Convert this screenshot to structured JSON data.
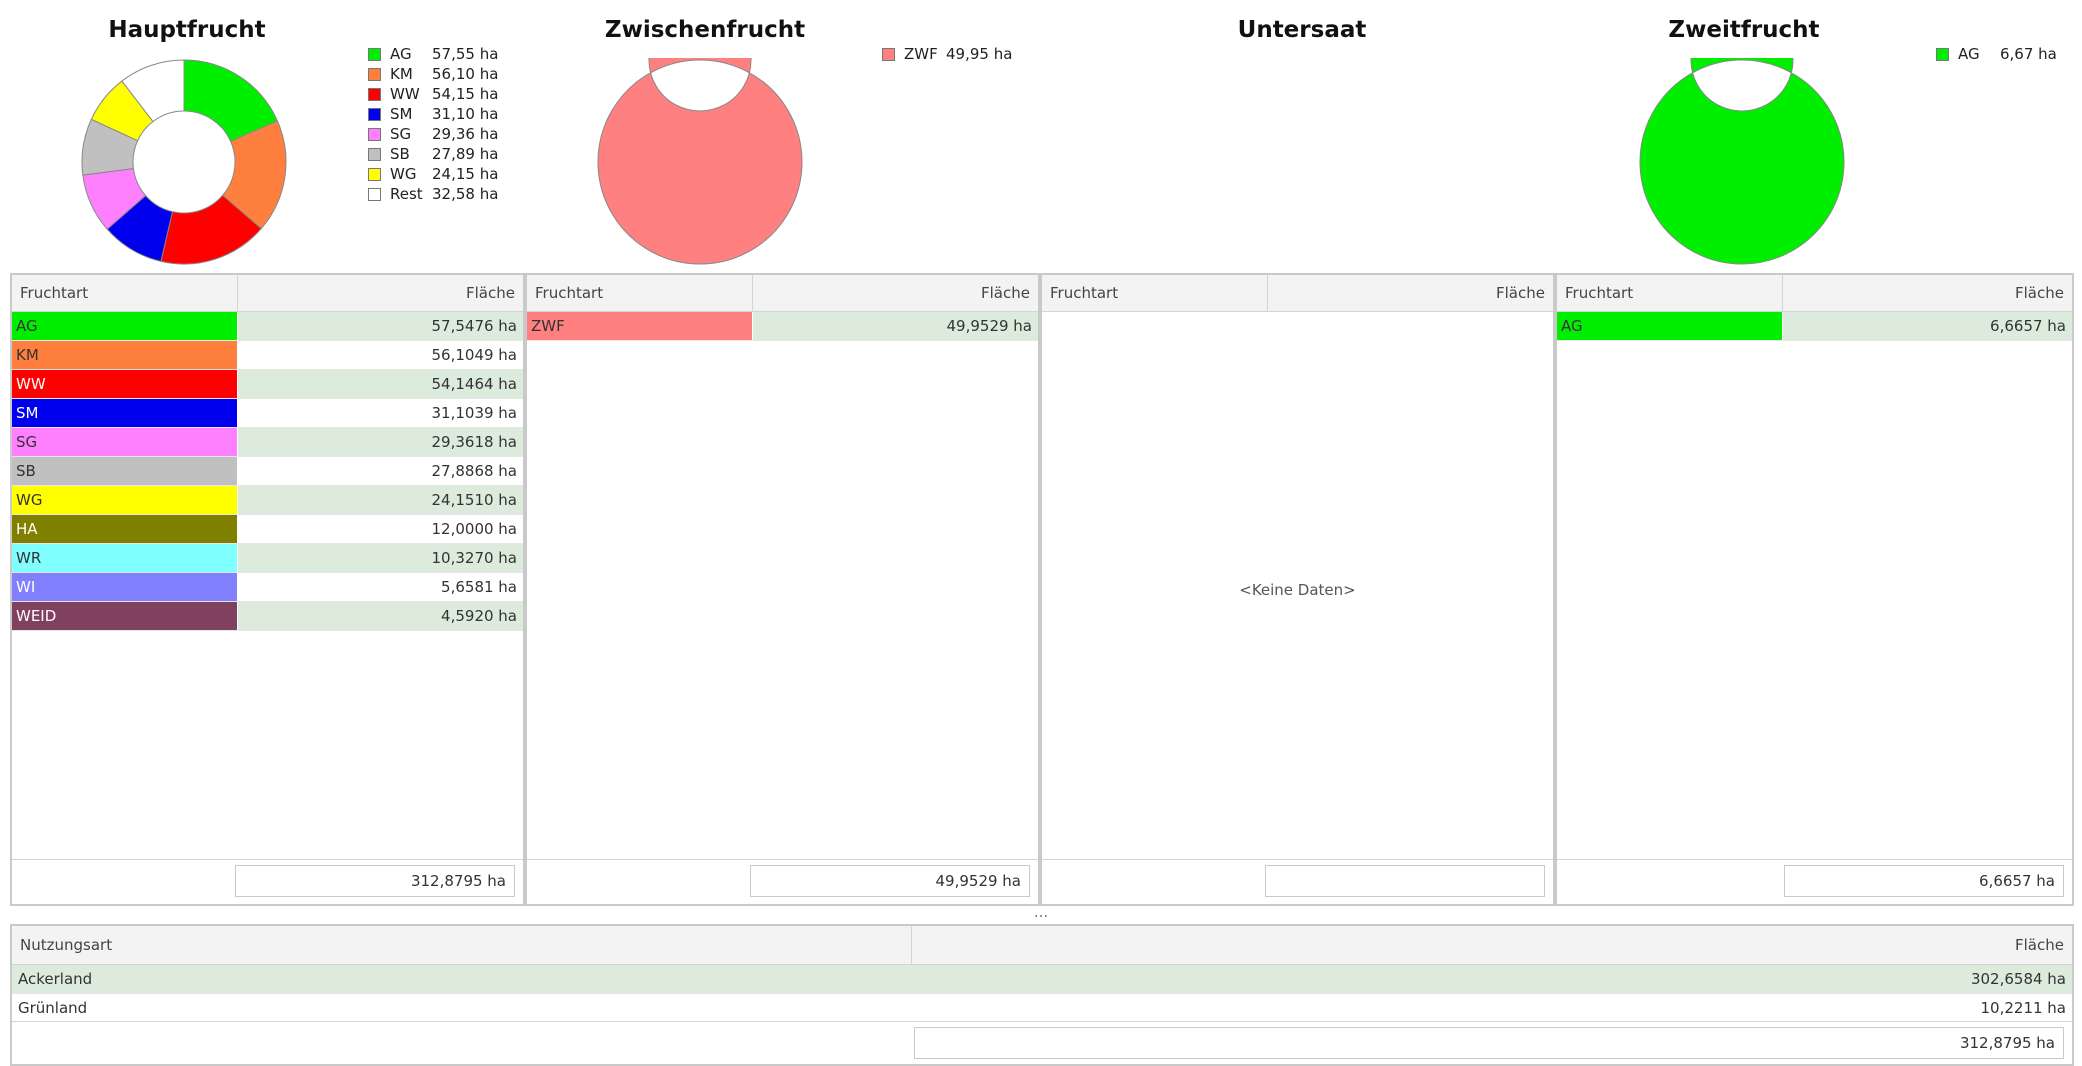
{
  "charts": {
    "hauptfrucht": {
      "title": "Hauptfrucht",
      "legend": [
        {
          "code": "AG",
          "value": "57,55 ha",
          "color": "#00ee00"
        },
        {
          "code": "KM",
          "value": "56,10 ha",
          "color": "#ff7f3f"
        },
        {
          "code": "WW",
          "value": "54,15 ha",
          "color": "#ff0000"
        },
        {
          "code": "SM",
          "value": "31,10 ha",
          "color": "#0000ee"
        },
        {
          "code": "SG",
          "value": "29,36 ha",
          "color": "#ff80ff"
        },
        {
          "code": "SB",
          "value": "27,89 ha",
          "color": "#c0c0c0"
        },
        {
          "code": "WG",
          "value": "24,15 ha",
          "color": "#ffff00"
        },
        {
          "code": "Rest",
          "value": "32,58 ha",
          "color": "#ffffff"
        }
      ]
    },
    "zwischenfrucht": {
      "title": "Zwischenfrucht",
      "legend": [
        {
          "code": "ZWF",
          "value": "49,95 ha",
          "color": "#ff8080"
        }
      ]
    },
    "untersaat": {
      "title": "Untersaat",
      "legend": []
    },
    "zweitfrucht": {
      "title": "Zweitfrucht",
      "legend": [
        {
          "code": "AG",
          "value": "6,67 ha",
          "color": "#00ee00"
        }
      ]
    }
  },
  "chart_data": [
    {
      "type": "pie",
      "title": "Hauptfrucht",
      "categories": [
        "AG",
        "KM",
        "WW",
        "SM",
        "SG",
        "SB",
        "WG",
        "Rest"
      ],
      "values": [
        57.55,
        56.1,
        54.15,
        31.1,
        29.36,
        27.89,
        24.15,
        32.58
      ],
      "colors": [
        "#00ee00",
        "#ff7f3f",
        "#ff0000",
        "#0000ee",
        "#ff80ff",
        "#c0c0c0",
        "#ffff00",
        "#ffffff"
      ],
      "legend": "right"
    },
    {
      "type": "pie",
      "title": "Zwischenfrucht",
      "categories": [
        "ZWF"
      ],
      "values": [
        49.95
      ],
      "colors": [
        "#ff8080"
      ],
      "legend": "right"
    },
    {
      "type": "pie",
      "title": "Untersaat",
      "categories": [],
      "values": [],
      "colors": []
    },
    {
      "type": "pie",
      "title": "Zweitfrucht",
      "categories": [
        "AG"
      ],
      "values": [
        6.67
      ],
      "colors": [
        "#00ee00"
      ],
      "legend": "right"
    }
  ],
  "grids": {
    "hauptfrucht": {
      "col_name": "Fruchtart",
      "col_value": "Fläche",
      "rows": [
        {
          "name": "AG",
          "value": "57,5476 ha",
          "color": "#00ee00"
        },
        {
          "name": "KM",
          "value": "56,1049 ha",
          "color": "#ff7f3f"
        },
        {
          "name": "WW",
          "value": "54,1464 ha",
          "color": "#ff0000"
        },
        {
          "name": "SM",
          "value": "31,1039 ha",
          "color": "#0000ee"
        },
        {
          "name": "SG",
          "value": "29,3618 ha",
          "color": "#ff80ff"
        },
        {
          "name": "SB",
          "value": "27,8868 ha",
          "color": "#c0c0c0"
        },
        {
          "name": "WG",
          "value": "24,1510 ha",
          "color": "#ffff00"
        },
        {
          "name": "HA",
          "value": "12,0000 ha",
          "color": "#808000"
        },
        {
          "name": "WR",
          "value": "10,3270 ha",
          "color": "#80ffff"
        },
        {
          "name": "WI",
          "value": "5,6581 ha",
          "color": "#8080ff"
        },
        {
          "name": "WEID",
          "value": "4,5920 ha",
          "color": "#804060"
        }
      ],
      "total": "312,8795 ha"
    },
    "zwischenfrucht": {
      "col_name": "Fruchtart",
      "col_value": "Fläche",
      "rows": [
        {
          "name": "ZWF",
          "value": "49,9529 ha",
          "color": "#ff8080"
        }
      ],
      "total": "49,9529 ha"
    },
    "untersaat": {
      "col_name": "Fruchtart",
      "col_value": "Fläche",
      "rows": [],
      "no_data": "<Keine Daten>",
      "total": ""
    },
    "zweitfrucht": {
      "col_name": "Fruchtart",
      "col_value": "Fläche",
      "rows": [
        {
          "name": "AG",
          "value": "6,6657 ha",
          "color": "#00ee00"
        }
      ],
      "total": "6,6657 ha"
    }
  },
  "splitter": "...",
  "nutzung": {
    "col_name": "Nutzungsart",
    "col_value": "Fläche",
    "rows": [
      {
        "name": "Ackerland",
        "value": "302,6584 ha"
      },
      {
        "name": "Grünland",
        "value": "10,2211 ha"
      }
    ],
    "total": "312,8795 ha"
  }
}
